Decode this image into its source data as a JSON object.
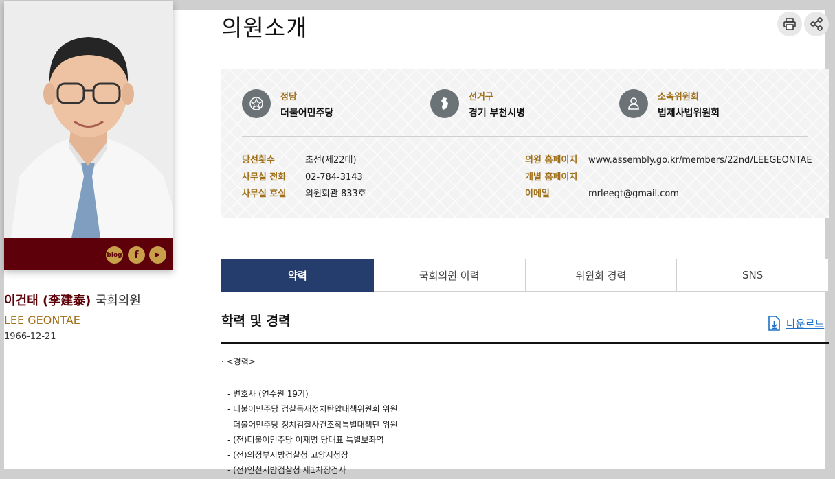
{
  "page": {
    "title": "의원소개"
  },
  "profile": {
    "name_ko": "이건태 (李建泰)",
    "name_suffix": "국회의원",
    "name_en": "LEE GEONTAE",
    "birth": "1966-12-21",
    "sns": [
      {
        "label": "blog",
        "icon": "blog-icon"
      },
      {
        "label": "f",
        "icon": "facebook-icon"
      },
      {
        "label": "▶",
        "icon": "youtube-icon"
      }
    ]
  },
  "info": {
    "party": {
      "label": "정당",
      "value": "더불어민주당",
      "icon": "party-emblem-icon"
    },
    "district": {
      "label": "선거구",
      "value": "경기 부천시병",
      "icon": "korea-map-icon"
    },
    "committee": {
      "label": "소속위원회",
      "value": "법제사법위원회",
      "icon": "person-icon"
    },
    "details_left": [
      {
        "label": "당선횟수",
        "value": "초선(제22대)"
      },
      {
        "label": "사무실 전화",
        "value": "02-784-3143"
      },
      {
        "label": "사무실 호실",
        "value": "의원회관 833호"
      }
    ],
    "details_right": [
      {
        "label": "의원 홈페이지",
        "value": "www.assembly.go.kr/members/22nd/LEEGEONTAE"
      },
      {
        "label": "개별 홈페이지",
        "value": ""
      },
      {
        "label": "이메일",
        "value": "mrleegt@gmail.com"
      }
    ]
  },
  "tabs": [
    {
      "label": "약력",
      "active": true
    },
    {
      "label": "국회의원 이력",
      "active": false
    },
    {
      "label": "위원회 경력",
      "active": false
    },
    {
      "label": "SNS",
      "active": false
    }
  ],
  "section": {
    "title": "학력 및 경력",
    "download_label": "다운로드",
    "career_heading": "· <경력>",
    "career_items": [
      "- 변호사 (연수원 19기)",
      "- 더불어민주당 검찰독재정치탄압대책위원회 위원",
      "- 더불어민주당 정치검찰사건조작특별대책단 위원",
      "- (전)더불어민주당 이재명 당대표 특별보좌역",
      "- (전)의정부지방검찰청 고양지청장",
      "- (전)인천지방검찰청 제1차장검사"
    ]
  },
  "colors": {
    "accent_maroon": "#5e0009",
    "accent_gold": "#a0701a",
    "tab_active": "#243d6c",
    "link_blue": "#1e6fc8"
  }
}
